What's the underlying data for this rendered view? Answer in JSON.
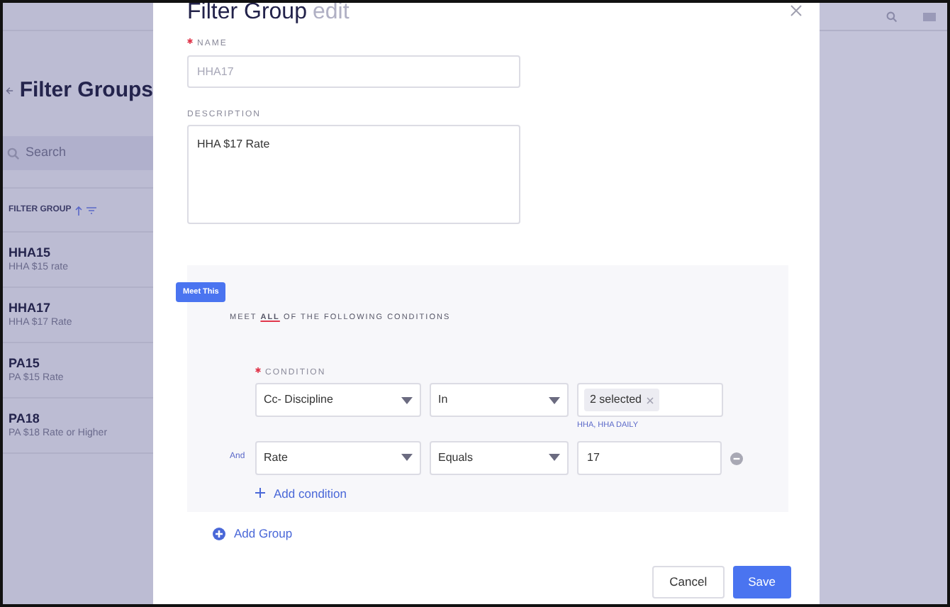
{
  "background_page": {
    "title": "Filter Groups",
    "search": {
      "placeholder": "Search"
    },
    "column_header": "FILTER GROUP",
    "rows": [
      {
        "name": "HHA15",
        "description": "HHA $15 rate"
      },
      {
        "name": "HHA17",
        "description": "HHA $17 Rate"
      },
      {
        "name": "PA15",
        "description": "PA $15 Rate"
      },
      {
        "name": "PA18",
        "description": "PA $18 Rate or Higher"
      }
    ]
  },
  "dialog": {
    "title": "Filter Group",
    "title_suffix": "edit",
    "name_field": {
      "label": "NAME",
      "required": true,
      "placeholder": "HHA17"
    },
    "description_field": {
      "label": "DESCRIPTION",
      "required": false,
      "value": "HHA $17 Rate"
    },
    "group": {
      "badge": "Meet This",
      "rule_prefix": "MEET",
      "rule_match": "ALL",
      "rule_suffix": "OF THE FOLLOWING CONDITIONS",
      "condition_label": "CONDITION",
      "condition_required": true,
      "conditions": [
        {
          "field": "Cc- Discipline",
          "operator": "In",
          "kind": "tags",
          "tag": "2 selected",
          "helper": "HHA, HHA DAILY",
          "removable": false
        },
        {
          "connector": "And",
          "field": "Rate",
          "operator": "Equals",
          "kind": "text",
          "value": "17",
          "removable": true
        }
      ],
      "add_condition": "Add condition"
    },
    "add_group": "Add Group",
    "buttons": [
      {
        "label": "Cancel",
        "kind": "secondary"
      },
      {
        "label": "Save",
        "kind": "primary"
      }
    ]
  }
}
